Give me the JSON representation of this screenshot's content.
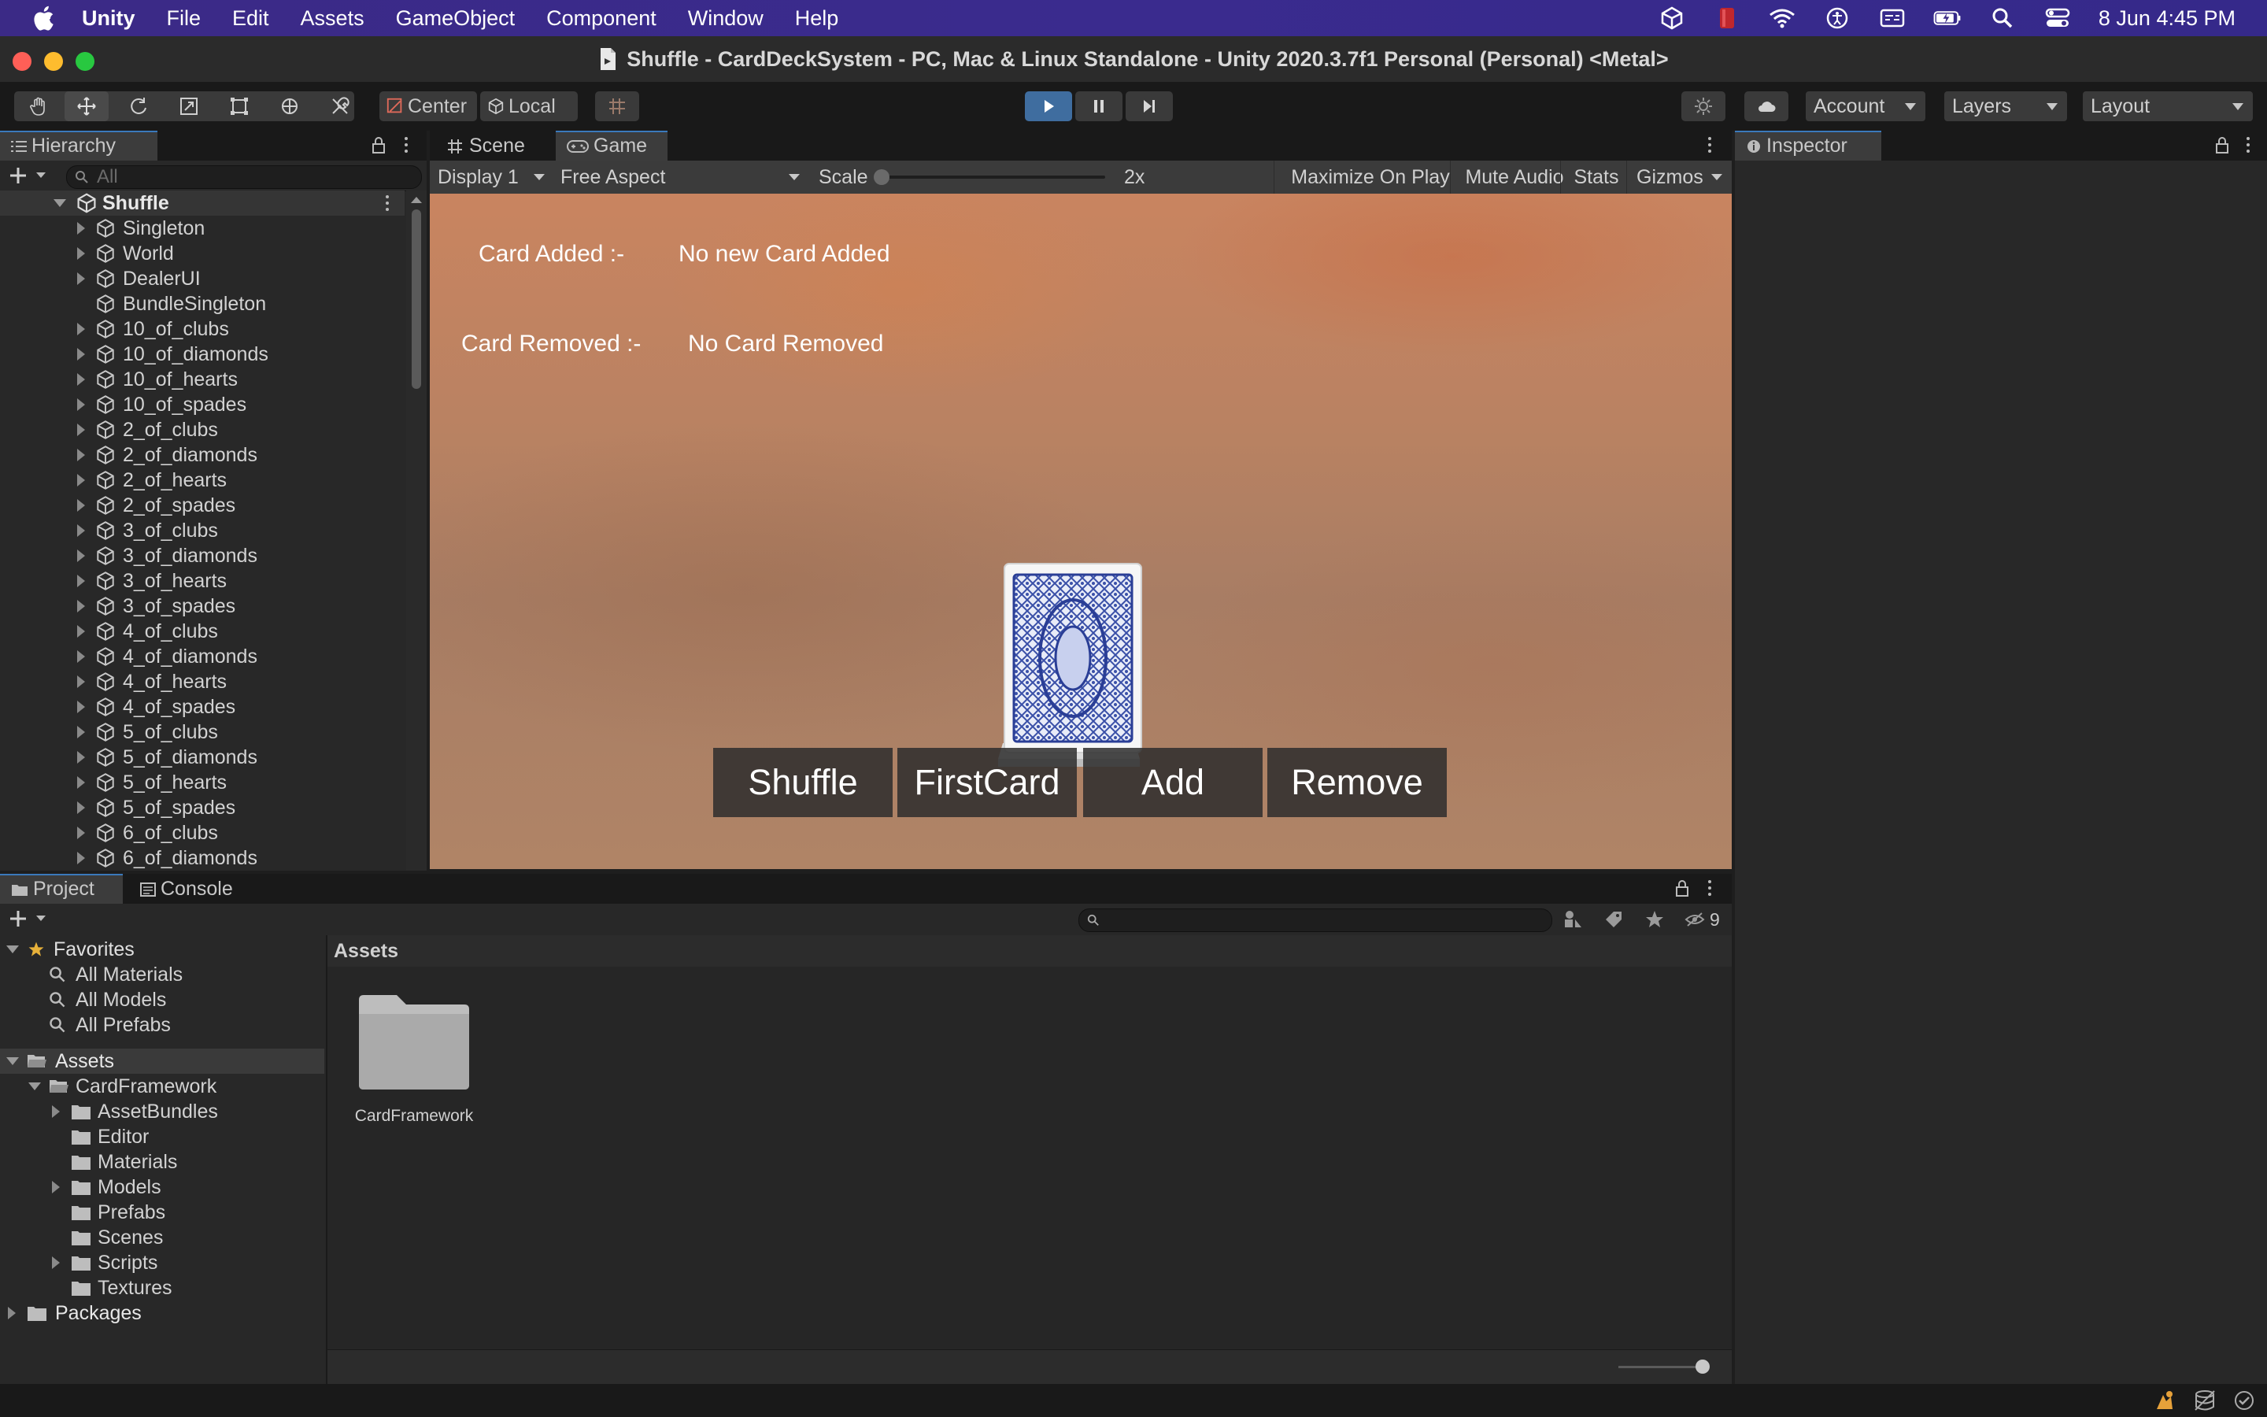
{
  "menubar": {
    "app_name": "Unity",
    "items": [
      "File",
      "Edit",
      "Assets",
      "GameObject",
      "Component",
      "Window",
      "Help"
    ],
    "clock": "8 Jun  4:45 PM",
    "status_icons": [
      "unity-icon",
      "red-app-icon",
      "wifi-icon",
      "accessibility-icon",
      "keyboard-input-icon",
      "battery-icon",
      "spotlight-search-icon",
      "control-center-icon"
    ]
  },
  "window": {
    "title": "Shuffle - CardDeckSystem - PC, Mac & Linux Standalone - Unity 2020.3.7f1 Personal (Personal) <Metal>"
  },
  "toolbar": {
    "pivot_label": "Center",
    "space_label": "Local",
    "account_label": "Account",
    "layers_label": "Layers",
    "layout_label": "Layout",
    "playing": true
  },
  "hierarchy": {
    "tab_label": "Hierarchy",
    "search_placeholder": "All",
    "scene_name": "Shuffle",
    "items": [
      "Singleton",
      "World",
      "DealerUI",
      "BundleSingleton",
      "10_of_clubs",
      "10_of_diamonds",
      "10_of_hearts",
      "10_of_spades",
      "2_of_clubs",
      "2_of_diamonds",
      "2_of_hearts",
      "2_of_spades",
      "3_of_clubs",
      "3_of_diamonds",
      "3_of_hearts",
      "3_of_spades",
      "4_of_clubs",
      "4_of_diamonds",
      "4_of_hearts",
      "4_of_spades",
      "5_of_clubs",
      "5_of_diamonds",
      "5_of_hearts",
      "5_of_spades",
      "6_of_clubs",
      "6_of_diamonds"
    ]
  },
  "view_tabs": {
    "scene": "Scene",
    "game": "Game"
  },
  "game_bar": {
    "display": "Display 1",
    "aspect": "Free Aspect",
    "scale_label": "Scale",
    "scale_value": "2x",
    "maximize": "Maximize On Play",
    "mute": "Mute Audio",
    "stats": "Stats",
    "gizmos": "Gizmos"
  },
  "game": {
    "card_added_label": "Card Added :-",
    "card_added_value": "No new Card Added",
    "card_removed_label": "Card Removed :-",
    "card_removed_value": "No Card Removed",
    "buttons": [
      "Shuffle",
      "FirstCard",
      "Add",
      "Remove"
    ]
  },
  "inspector": {
    "tab_label": "Inspector"
  },
  "project": {
    "tab_project": "Project",
    "tab_console": "Console",
    "hidden_count": "9",
    "favorites_label": "Favorites",
    "favorites": [
      "All Materials",
      "All Models",
      "All Prefabs"
    ],
    "assets_label": "Assets",
    "card_framework": "CardFramework",
    "subfolders": [
      "AssetBundles",
      "Editor",
      "Materials",
      "Models",
      "Prefabs",
      "Scenes",
      "Scripts",
      "Textures"
    ],
    "packages_label": "Packages",
    "breadcrumb": "Assets",
    "grid_items": [
      "CardFramework"
    ]
  }
}
